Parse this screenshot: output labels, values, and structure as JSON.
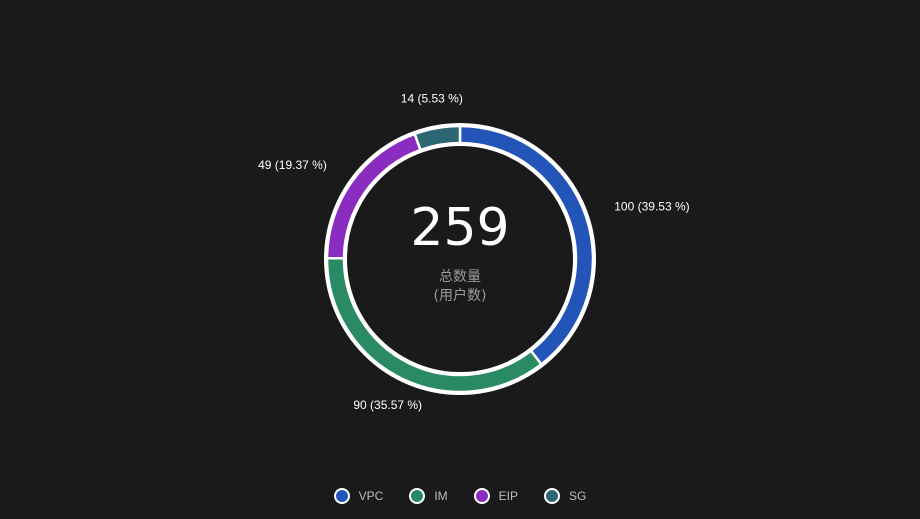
{
  "chart_data": {
    "type": "pie",
    "variant": "donut",
    "total": "259",
    "center_caption": [
      "总数量",
      "(用户数)"
    ],
    "slices": [
      {
        "name": "VPC",
        "value": 100,
        "percent": "39.53 %",
        "label": "100  (39.53 %)",
        "color": "#2355b8"
      },
      {
        "name": "IM",
        "value": 90,
        "percent": "35.57 %",
        "label": "90  (35.57 %)",
        "color": "#2a8a64"
      },
      {
        "name": "EIP",
        "value": 49,
        "percent": "19.37 %",
        "label": "49  (19.37 %)",
        "color": "#8b2cc0"
      },
      {
        "name": "SG",
        "value": 14,
        "percent": "5.53 %",
        "label": "14  (5.53 %)",
        "color": "#2c6673"
      }
    ],
    "legend_position": "bottom-center"
  },
  "legend": {
    "items": [
      {
        "label": "VPC",
        "color": "#2355b8"
      },
      {
        "label": "IM",
        "color": "#2a8a64"
      },
      {
        "label": "EIP",
        "color": "#8b2cc0"
      },
      {
        "label": "SG",
        "color": "#2c6673"
      }
    ]
  },
  "colors": {
    "background": "#1a1a1a",
    "ring_border": "#ffffff"
  }
}
